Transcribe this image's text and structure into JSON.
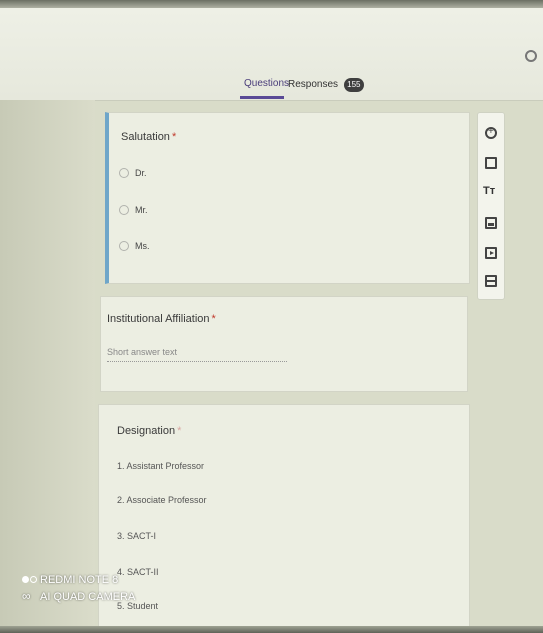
{
  "tabs": [
    {
      "label": "Questions"
    },
    {
      "label": "Responses",
      "badge": "155"
    }
  ],
  "questions": [
    {
      "title": "Salutation",
      "required_mark": "*",
      "options": [
        "Dr.",
        "Mr.",
        "Ms."
      ]
    },
    {
      "title": "Institutional Affiliation",
      "required_mark": "*",
      "placeholder": "Short answer text"
    },
    {
      "title": "Designation",
      "required_mark": "*",
      "options": [
        "1.  Assistant Professor",
        "2.  Associate Professor",
        "3.  SACT-I",
        "4.  SACT-II",
        "5.  Student"
      ]
    }
  ],
  "toolbar": {
    "icons": [
      "add-question-icon",
      "import-questions-icon",
      "add-title-icon",
      "add-image-icon",
      "add-video-icon",
      "add-section-icon"
    ],
    "title_glyph": "Tт"
  },
  "watermark": {
    "line1": "REDMI NOTE 8",
    "line2": "AI QUAD CAMERA"
  },
  "colors": {
    "accent": "#5a4a96",
    "card_border_active": "#6fa6c9",
    "required": "#c0392b"
  }
}
